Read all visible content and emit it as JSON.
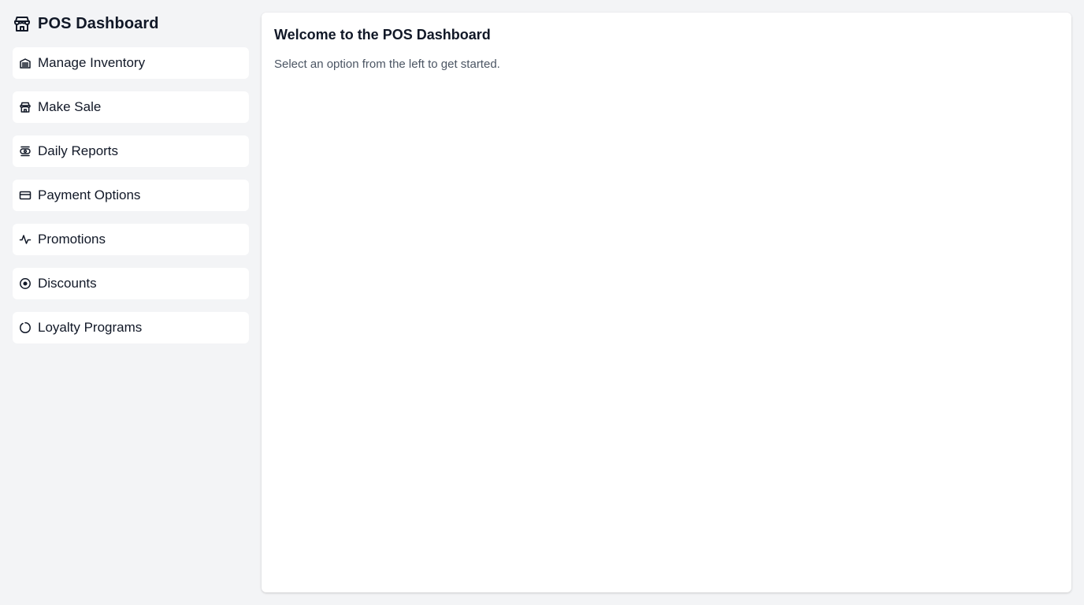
{
  "sidebar": {
    "brand": {
      "title": "POS Dashboard",
      "icon": "store-icon"
    },
    "items": [
      {
        "label": "Manage Inventory",
        "icon": "inventory-icon"
      },
      {
        "label": "Make Sale",
        "icon": "store-icon"
      },
      {
        "label": "Daily Reports",
        "icon": "reports-icon"
      },
      {
        "label": "Payment Options",
        "icon": "credit-card-icon"
      },
      {
        "label": "Promotions",
        "icon": "activity-icon"
      },
      {
        "label": "Discounts",
        "icon": "target-icon"
      },
      {
        "label": "Loyalty Programs",
        "icon": "circle-icon"
      }
    ]
  },
  "main": {
    "title": "Welcome to the POS Dashboard",
    "subtitle": "Select an option from the left to get started."
  },
  "colors": {
    "background": "#f3f4f6",
    "card": "#ffffff",
    "text": "#111827",
    "muted_text": "#4b5563"
  }
}
